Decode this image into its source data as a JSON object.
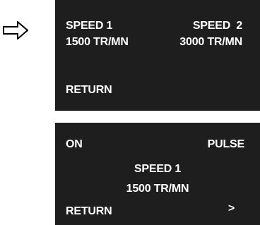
{
  "indicator": {
    "icon": "right-arrow-icon"
  },
  "screen1": {
    "speed1_label": "SPEED 1",
    "speed1_value": "1500 TR/MN",
    "speed2_label": "SPEED 2",
    "speed2_value": "3000 TR/MN",
    "return_label": "RETURN"
  },
  "screen2": {
    "on_label": "ON",
    "pulse_label": "PULSE",
    "speed_label": "SPEED 1",
    "speed_value": "1500 TR/MN",
    "return_label": "RETURN",
    "next_label": ">"
  },
  "colors": {
    "screen_background": "#1e1e1e",
    "text": "#ffffff",
    "page_background": "#ffffff"
  }
}
